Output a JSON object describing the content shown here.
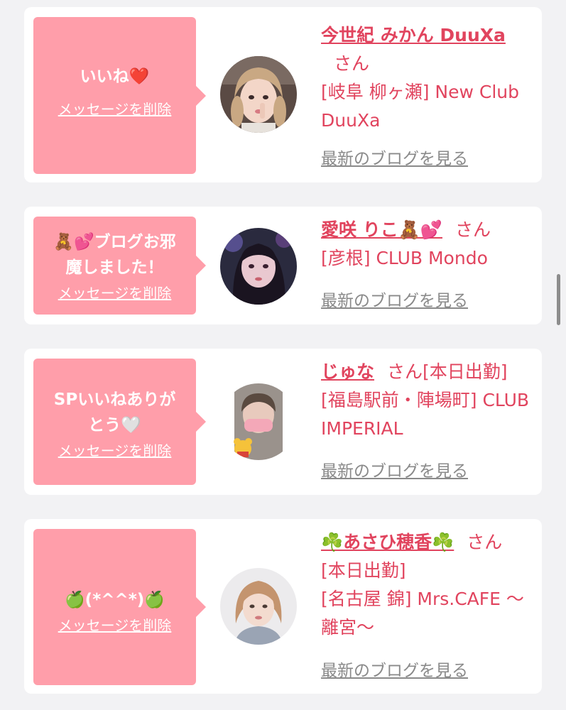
{
  "cards": [
    {
      "message": "いいね❤️",
      "delete_label": "メッセージを削除",
      "name": "今世紀 みかん DuuXa",
      "honorific": "さん",
      "extra": "",
      "venue": "[岐阜 柳ヶ瀬] New Club DuuXa",
      "blog_label": "最新のブログを見る"
    },
    {
      "message": "🧸💕ブログお邪魔しました！",
      "delete_label": "メッセージを削除",
      "name": "愛咲 りこ🧸💕",
      "honorific": "さん",
      "extra": "",
      "venue": "[彦根] CLUB Mondo",
      "blog_label": "最新のブログを見る"
    },
    {
      "message": "SPいいねありがとう🤍",
      "delete_label": "メッセージを削除",
      "name": "じゅな",
      "honorific": "さん",
      "extra": "[本日出勤]",
      "venue": "[福島駅前・陣場町] CLUB IMPERIAL",
      "blog_label": "最新のブログを見る"
    },
    {
      "message": "🍏(*^^*)🍏",
      "delete_label": "メッセージを削除",
      "name": "☘️あさひ穂香☘️",
      "honorific": "さん",
      "extra": "[本日出勤]",
      "venue": "[名古屋 錦] Mrs.CAFE 〜離宮〜",
      "blog_label": "最新のブログを見る"
    }
  ],
  "colors": {
    "bubble": "#ff9eaa",
    "accent": "#e1445e",
    "link_gray": "#8a8a8a",
    "background": "#f2f2f4"
  }
}
